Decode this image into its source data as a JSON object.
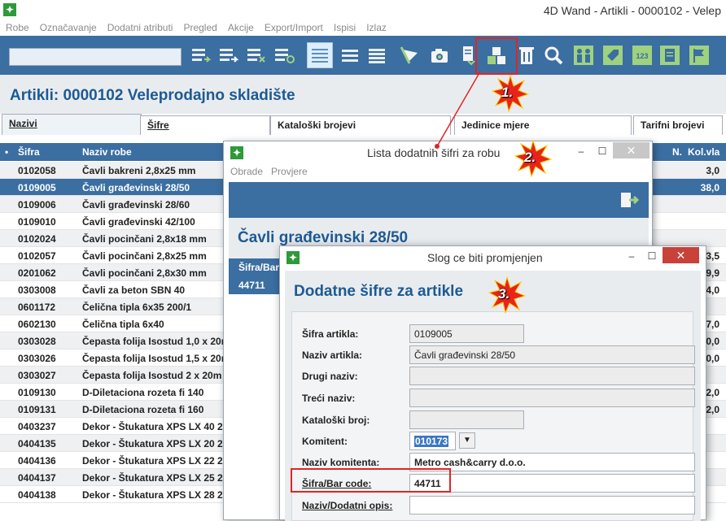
{
  "app": {
    "title": "4D Wand - Artikli - 0000102 - Velep",
    "icon": "app-logo-icon"
  },
  "menu": [
    "Robe",
    "Označavanje",
    "Dodatni atributi",
    "Pregled",
    "Akcije",
    "Export/Import",
    "Ispisi",
    "Izlaz"
  ],
  "toolbar": {
    "search_value": "",
    "badge_123": "123"
  },
  "page": {
    "title": "Artikli: 0000102 Veleprodajno skladište"
  },
  "tabs": [
    "Nazivi",
    "Šifre",
    "Kataloški brojevi",
    "Jedinice mjere",
    "Tarifni brojevi"
  ],
  "grid": {
    "columns": {
      "marker": "•",
      "code": "Šifra",
      "name": "Naziv robe",
      "col_n": "N.",
      "qty": "Kol.vla"
    },
    "rows": [
      {
        "code": "0102058",
        "name": "Čavli bakreni 2,8x25 mm",
        "qty": "3,0"
      },
      {
        "code": "0109005",
        "name": "Čavli građevinski 28/50",
        "qty": "38,0"
      },
      {
        "code": "0109006",
        "name": "Čavli građevinski 28/60",
        "qty": ""
      },
      {
        "code": "0109010",
        "name": "Čavli građevinski 42/100",
        "qty": ""
      },
      {
        "code": "0102024",
        "name": "Čavli pocinčani 2,8x18 mm",
        "qty": ""
      },
      {
        "code": "0102057",
        "name": "Čavli pocinčani 2,8x25 mm",
        "qty": "3,5"
      },
      {
        "code": "0201062",
        "name": "Čavli pocinčani 2,8x30 mm",
        "qty": "9,9"
      },
      {
        "code": "0303008",
        "name": "Čavli za beton SBN 40",
        "qty": "4,0"
      },
      {
        "code": "0601172",
        "name": "Čelična tipla 6x35 200/1",
        "qty": ""
      },
      {
        "code": "0602130",
        "name": "Čelična tipla 6x40",
        "qty": "7,0"
      },
      {
        "code": "0303028",
        "name": "Čepasta folija Isostud 1,0 x 20m",
        "qty": "0,0"
      },
      {
        "code": "0303026",
        "name": "Čepasta folija Isostud 1,5 x 20m",
        "qty": "0,0"
      },
      {
        "code": "0303027",
        "name": "Čepasta folija Isostud 2 x 20m",
        "qty": ""
      },
      {
        "code": "0109130",
        "name": "D-Diletaciona rozeta fi 140",
        "qty": "2,0"
      },
      {
        "code": "0109131",
        "name": "D-Diletaciona rozeta fi 160",
        "qty": "2,0"
      },
      {
        "code": "0403237",
        "name": "Dekor - Štukatura  XPS  LX 40 2",
        "qty": ""
      },
      {
        "code": "0404135",
        "name": "Dekor - Štukatura XPS  LX 20 2",
        "qty": ""
      },
      {
        "code": "0404136",
        "name": "Dekor - Štukatura XPS  LX 22 2",
        "qty": ""
      },
      {
        "code": "0404137",
        "name": "Dekor - Štukatura XPS  LX 25 2",
        "qty": ""
      },
      {
        "code": "0404138",
        "name": "Dekor - Štukatura XPS  LX 28 2",
        "qty": ""
      }
    ]
  },
  "window2": {
    "title": "Lista dodatnih šifri za robu",
    "menu": [
      "Obrade",
      "Provjere"
    ],
    "heading": "Čavli građevinski 28/50",
    "col_header": "Šifra/Bar",
    "row_value": "44711"
  },
  "window3": {
    "title": "Slog ce biti promjenjen",
    "heading": "Dodatne šifre za artikle",
    "fields": {
      "sifra_artikla": {
        "label": "Šifra artikla:",
        "value": "0109005"
      },
      "naziv_artikla": {
        "label": "Naziv artikla:",
        "value": "Čavli građevinski 28/50"
      },
      "drugi_naziv": {
        "label": "Drugi naziv:",
        "value": ""
      },
      "treci_naziv": {
        "label": "Treći naziv:",
        "value": ""
      },
      "kataloski_broj": {
        "label": "Kataloški broj:",
        "value": ""
      },
      "komitent": {
        "label": "Komitent:",
        "value": "010173"
      },
      "naziv_komitenta": {
        "label": "Naziv komitenta:",
        "value": "Metro cash&carry d.o.o."
      },
      "sifra_bar_code": {
        "label": "Šifra/Bar code:",
        "value": "44711"
      },
      "naziv_dodatni_opis": {
        "label": "Naziv/Dodatni opis:",
        "value": ""
      }
    }
  },
  "callouts": [
    "1.",
    "2.",
    "3."
  ],
  "window_controls": {
    "minimize": "–",
    "maximize": "☐",
    "close": "✕"
  },
  "colors": {
    "accent": "#3b6ea1",
    "heading": "#1d5a93",
    "highlight": "#e02525",
    "callout": "#e8231b"
  }
}
